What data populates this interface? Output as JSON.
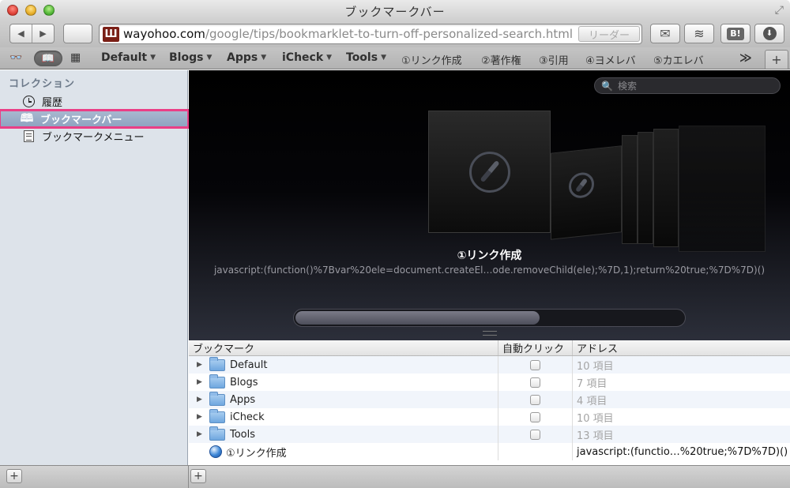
{
  "window": {
    "title": "ブックマークバー"
  },
  "toolbar": {
    "back_icon": "◀",
    "forward_icon": "▶",
    "favicon_text": "Ш",
    "url_host": "wayohoo.com",
    "url_path": "/google/tips/bookmarklet-to-turn-off-personalized-search.html",
    "reader_label": "リーダー",
    "mail_icon": "✉",
    "layer_icon": "≋",
    "hatena_label": "B!",
    "download_icon": "⬇"
  },
  "bookmark_bar": {
    "items": [
      {
        "label": "Default",
        "arrow": "▼"
      },
      {
        "label": "Blogs",
        "arrow": "▼"
      },
      {
        "label": "Apps",
        "arrow": "▼"
      },
      {
        "label": "iCheck",
        "arrow": "▼"
      },
      {
        "label": "Tools",
        "arrow": "▼"
      },
      {
        "label": "①リンク作成"
      },
      {
        "label": "②著作権"
      },
      {
        "label": "③引用"
      },
      {
        "label": "④ヨメレバ"
      },
      {
        "label": "⑤カエレバ"
      }
    ],
    "overflow_icon": "≫",
    "add_tab_icon": "+"
  },
  "sidebar": {
    "heading": "コレクション",
    "items": [
      {
        "label": "履歴",
        "icon": "clock-icon"
      },
      {
        "label": "ブックマークバー",
        "icon": "book-icon",
        "selected": true
      },
      {
        "label": "ブックマークメニュー",
        "icon": "menu-list-icon"
      }
    ],
    "selection_color": "#ea3f86"
  },
  "coverflow": {
    "search_placeholder": "検索",
    "title": "①リンク作成",
    "url": "javascript:(function()%7Bvar%20ele=document.createEl…ode.removeChild(ele);%7D,1);return%20true;%7D%7D)()",
    "scroll_position": 0.63
  },
  "table": {
    "headers": [
      "ブックマーク",
      "自動クリック",
      "アドレス"
    ],
    "rows": [
      {
        "name": "Default",
        "type": "folder",
        "address": "10 項目"
      },
      {
        "name": "Blogs",
        "type": "folder",
        "address": "7 項目"
      },
      {
        "name": "Apps",
        "type": "folder",
        "address": "4 項目"
      },
      {
        "name": "iCheck",
        "type": "folder",
        "address": "10 項目"
      },
      {
        "name": "Tools",
        "type": "folder",
        "address": "13 項目"
      },
      {
        "name": "①リンク作成",
        "type": "bookmarklet",
        "address": "javascript:(functio…%20true;%7D%7D)()"
      }
    ]
  },
  "bottom_bar": {
    "add_icon": "+"
  }
}
